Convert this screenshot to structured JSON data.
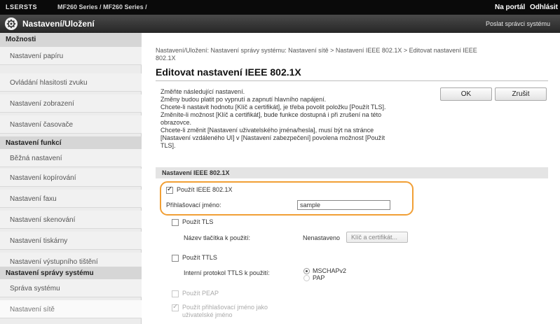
{
  "topbar": {
    "brand": "LSERSTS",
    "model": "MF260 Series / MF260 Series /",
    "portal_link": "Na portál",
    "logout_link": "Odhlásit"
  },
  "header": {
    "title": "Nastavení/Uložení",
    "mail_link": "Poslat správci systému",
    "icon": "settings-gear-icon"
  },
  "sidebar": {
    "sections": [
      {
        "title": "Možnosti",
        "items": [
          "Nastavení papíru",
          "Ovládání hlasitosti zvuku",
          "Nastavení zobrazení",
          "Nastavení časovače"
        ]
      },
      {
        "title": "Nastavení funkcí",
        "items": [
          "Běžná nastavení",
          "Nastavení kopírování",
          "Nastavení faxu",
          "Nastavení skenování",
          "Nastavení tiskárny",
          "Nastavení výstupního tištění"
        ]
      },
      {
        "title": "Nastavení správy systému",
        "items": [
          "Správa systému",
          "Nastavení sítě"
        ]
      }
    ]
  },
  "main": {
    "breadcrumb_line1": "Nastavení/Uložení: Nastavení správy systému: Nastavení sítě > Nastavení IEEE 802.1X > Editovat nastavení IEEE",
    "breadcrumb_line2": "802.1X",
    "page_title": "Editovat nastavení IEEE 802.1X",
    "notes": [
      "Změňte následující nastavení.",
      "Změny budou platit po vypnutí a zapnutí hlavního napájení.",
      "Chcete-li nastavit hodnotu [Klíč a certifikát], je třeba povolit položku [Použít TLS].",
      "Změníte-li možnost [Klíč a certifikát], bude funkce dostupná i při zrušení na této",
      "obrazovce.",
      "Chcete-li změnit [Nastavení uživatelského jména/hesla], musí být na stránce",
      "[Nastavení vzdáleného UI] v [Nastavení zabezpečení] povolena možnost [Použít",
      "TLS]."
    ],
    "ok_button": "OK",
    "cancel_button": "Zrušit",
    "section_title": "Nastavení IEEE 802.1X",
    "use_ieee": {
      "label": "Použít IEEE 802.1X",
      "checked": true
    },
    "login_name": {
      "label": "Přihlašovací jméno:",
      "value": "sample"
    },
    "use_tls": {
      "label": "Použít TLS",
      "checked": false
    },
    "key_cert_row": {
      "label": "Název tlačítka k použití:",
      "status": "Nenastaveno",
      "button": "Klíč a certifikát..."
    },
    "use_ttls": {
      "label": "Použít TTLS",
      "checked": false
    },
    "ttls_protocol": {
      "label": "Interní protokol TTLS k použití:",
      "options": [
        "MSCHAPv2",
        "PAP"
      ],
      "selected": "MSCHAPv2"
    },
    "use_peap": {
      "label": "Použít PEAP",
      "checked": false
    },
    "use_login_as_user": {
      "label_line1": "Použít přihlašovací jméno jako",
      "label_line2": "uživatelské jméno",
      "checked": true
    },
    "highlight_color": "#f19f35"
  }
}
